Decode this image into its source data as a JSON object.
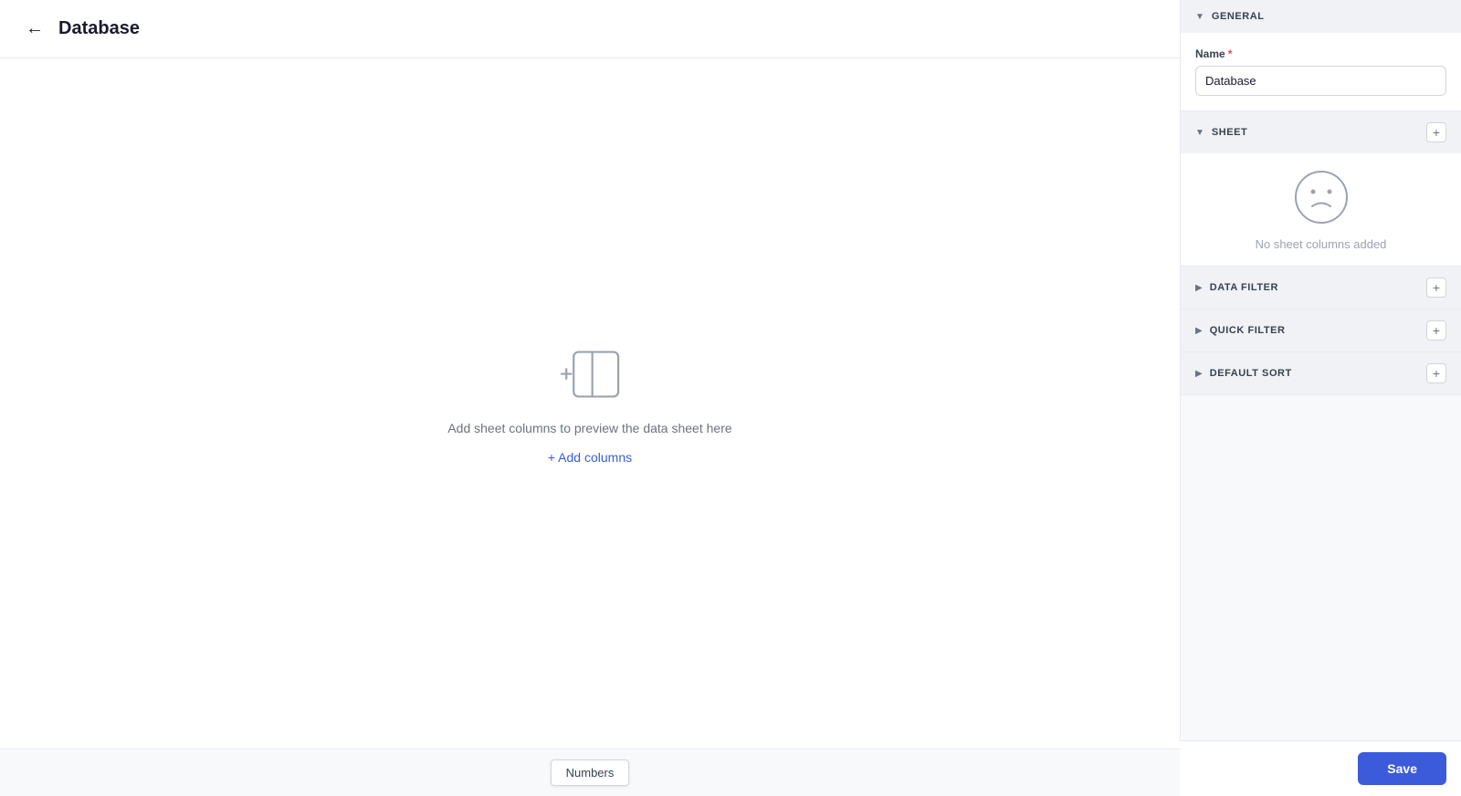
{
  "header": {
    "back_label": "←",
    "title": "Database"
  },
  "main": {
    "empty_state_text": "Add sheet columns to preview the data sheet here",
    "add_columns_label": "+ Add columns"
  },
  "bottom_bar": {
    "tab_label": "Numbers"
  },
  "right_panel": {
    "general_section_title": "GENERAL",
    "name_label": "Name",
    "name_value": "Database",
    "name_placeholder": "Database",
    "sheet_section_title": "SHEET",
    "no_columns_text": "No sheet columns added",
    "data_filter_title": "DATA FILTER",
    "quick_filter_title": "QUICK FILTER",
    "default_sort_title": "DEFAULT SORT",
    "save_label": "Save"
  }
}
